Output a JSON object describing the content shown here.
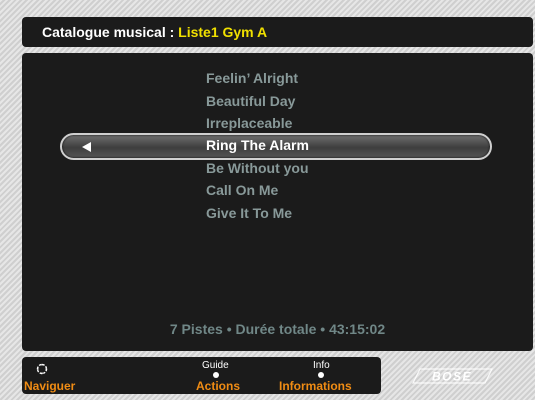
{
  "header": {
    "prefix": "Catalogue musical : ",
    "list_name": "Liste1 Gym A"
  },
  "tracks": [
    {
      "title": "Feelin’ Alright",
      "selected": false
    },
    {
      "title": "Beautiful Day",
      "selected": false
    },
    {
      "title": "Irreplaceable",
      "selected": false
    },
    {
      "title": "Ring The Alarm",
      "selected": true
    },
    {
      "title": "Be Without you",
      "selected": false
    },
    {
      "title": "Call On Me",
      "selected": false
    },
    {
      "title": "Give It To Me",
      "selected": false
    }
  ],
  "summary": "7 Pistes • Durée totale • 43:15:02",
  "bottom_bar": {
    "navigate_label": "Naviguer",
    "guide_caption": "Guide",
    "actions_label": "Actions",
    "info_caption": "Info",
    "informations_label": "Informations"
  },
  "brand": "BOSE",
  "icons": {
    "navigate": "dpad-icon",
    "selection": "left-arrow-icon"
  },
  "colors": {
    "list_name": "#f0e000",
    "button_labels": "#f08c14",
    "track_text": "#889999",
    "selected_text": "#ffffff",
    "summary_text": "#708787"
  }
}
